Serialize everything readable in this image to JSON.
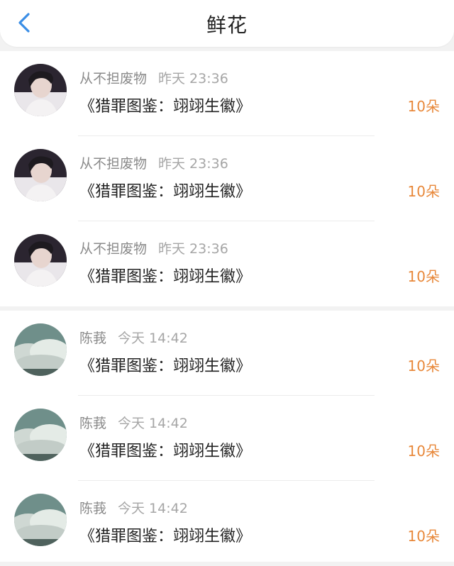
{
  "header": {
    "title": "鲜花",
    "back_icon": "chevron-left-icon",
    "accent_color": "#3a8ee6"
  },
  "items": [
    {
      "user": "从不担废物",
      "time": "昨天 23:36",
      "book": "《猎罪图鉴：翊翊生徽》",
      "count": "10朵",
      "avatar": "portrait-avatar"
    },
    {
      "user": "从不担废物",
      "time": "昨天 23:36",
      "book": "《猎罪图鉴：翊翊生徽》",
      "count": "10朵",
      "avatar": "portrait-avatar"
    },
    {
      "user": "从不担废物",
      "time": "昨天 23:36",
      "book": "《猎罪图鉴：翊翊生徽》",
      "count": "10朵",
      "avatar": "portrait-avatar"
    },
    {
      "user": "陈莪",
      "time": "今天 14:42",
      "book": "《猎罪图鉴：翊翊生徽》",
      "count": "10朵",
      "avatar": "sky-avatar"
    },
    {
      "user": "陈莪",
      "time": "今天 14:42",
      "book": "《猎罪图鉴：翊翊生徽》",
      "count": "10朵",
      "avatar": "sky-avatar"
    },
    {
      "user": "陈莪",
      "time": "今天 14:42",
      "book": "《猎罪图鉴：翊翊生徽》",
      "count": "10朵",
      "avatar": "sky-avatar"
    }
  ],
  "colors": {
    "count": "#e8883a",
    "meta": "#8a8a8a"
  }
}
